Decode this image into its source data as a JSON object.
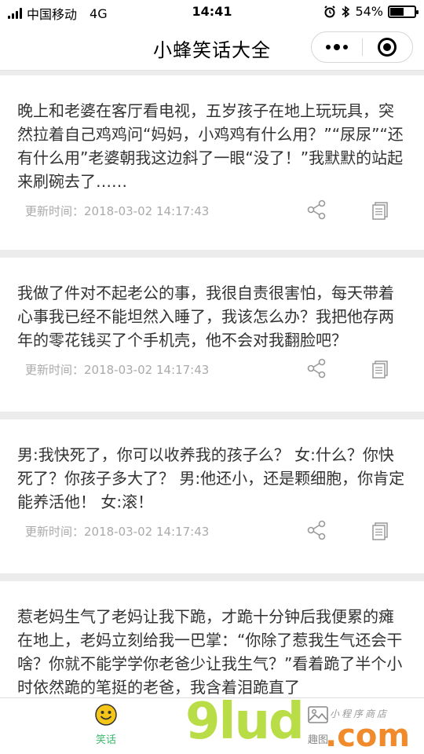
{
  "status_bar": {
    "carrier": "中国移动",
    "network": "4G",
    "time": "14:41",
    "battery": "54%"
  },
  "nav": {
    "title": "小蜂笑话大全"
  },
  "posts": [
    {
      "text": "晚上和老婆在客厅看电视，五岁孩子在地上玩玩具，突然拉着自己鸡鸡问“妈妈，小鸡鸡有什么用？”“尿尿”“还有什么用”老婆朝我这边斜了一眼“没了！”我默默的站起来刷碗去了……",
      "updated": "更新时间：2018-03-02 14:17:43"
    },
    {
      "text": "我做了件对不起老公的事，我很自责很害怕，每天带着心事我已经不能坦然入睡了，我该怎么办？我把他存两年的零花钱买了个手机壳，他不会对我翻脸吧？",
      "updated": "更新时间：2018-03-02 14:17:43"
    },
    {
      "text": "男:我快死了，你可以收养我的孩子么？ 女:什么？你快死了？你孩子多大了？ 男:他还小，还是颗细胞，你肯定能养活他！ 女:滚！",
      "updated": "更新时间：2018-03-02 14:17:43"
    },
    {
      "text": "惹老妈生气了老妈让我下跪，才跪十分钟后我便累的瘫在地上，老妈立刻给我一巴掌：“你除了惹我生气还会干啥？你就不能学学你老爸少让我生气？”看着跪了半个小时依然跪的笔挺的老爸，我含着泪跪直了",
      "updated": ""
    }
  ],
  "tabs": [
    {
      "label": "笑话",
      "icon": "smiley-icon",
      "active": true
    },
    {
      "label": "趣图",
      "icon": "image-icon",
      "active": false
    }
  ],
  "watermark": {
    "brand": "9lud",
    "suffix": ".com",
    "script": "小程序商店"
  },
  "colors": {
    "active_tab": "#3cb96b",
    "inactive_tab": "#888888",
    "meta_text": "#aaaaaa",
    "background": "#ececec",
    "smiley": "#f5c518",
    "watermark_green": "#b9dd47",
    "watermark_orange": "#f08a2b"
  }
}
